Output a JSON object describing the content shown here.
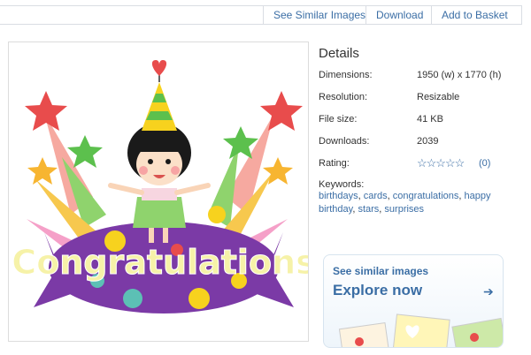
{
  "toolbar": {
    "see_similar": "See Similar Images",
    "download": "Download",
    "add_to_basket": "Add to Basket"
  },
  "image": {
    "text": "Congratulations"
  },
  "details": {
    "title": "Details",
    "dimensions_label": "Dimensions:",
    "dimensions_value": "1950 (w) x 1770 (h)",
    "resolution_label": "Resolution:",
    "resolution_value": "Resizable",
    "filesize_label": "File size:",
    "filesize_value": "41 KB",
    "downloads_label": "Downloads:",
    "downloads_value": "2039",
    "rating_label": "Rating:",
    "rating_stars": "☆☆☆☆☆",
    "rating_count": "(0)",
    "keywords_label": "Keywords:",
    "keywords": [
      "birthdays",
      "cards",
      "congratulations",
      "happy birthday",
      "stars",
      "surprises"
    ]
  },
  "promo": {
    "line1": "See similar images",
    "line2": "Explore now",
    "arrow": "➔"
  },
  "colors": {
    "link": "#3b6ea5",
    "border": "#d9dde3"
  }
}
